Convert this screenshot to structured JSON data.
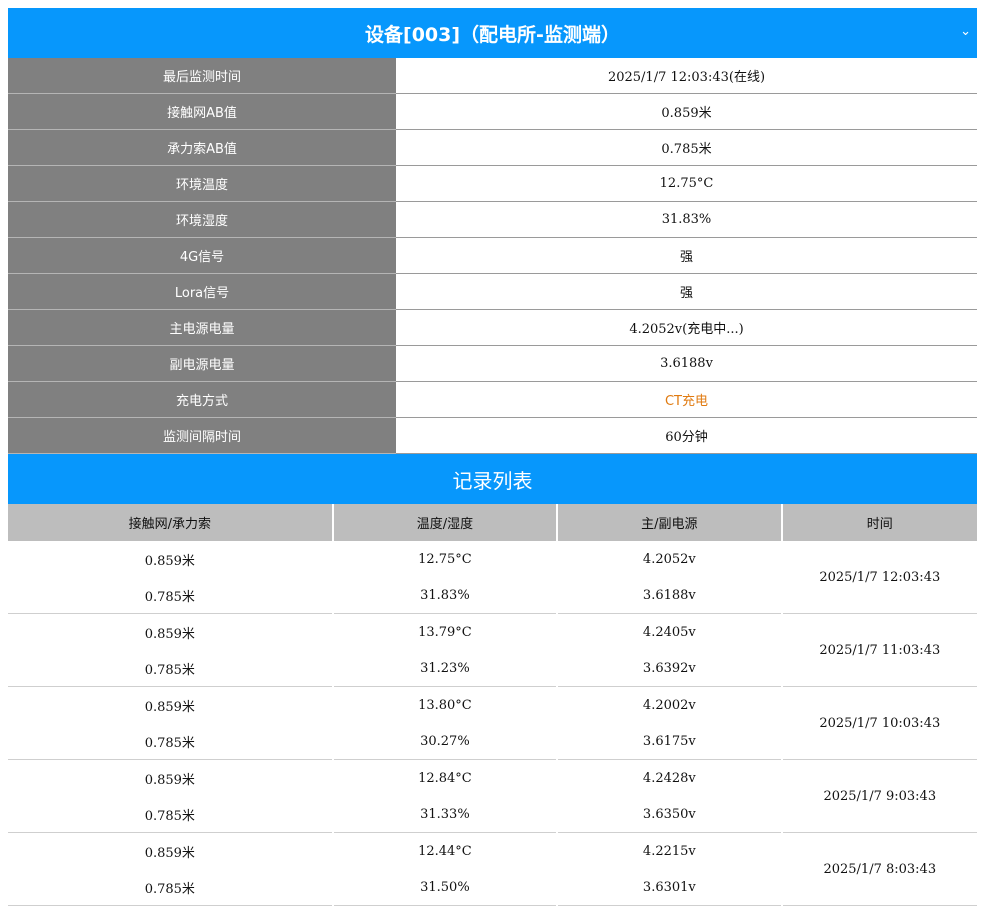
{
  "header": {
    "title": "设备[003]（配电所-监测端）",
    "collapse_icon": "chevron-down-icon"
  },
  "info": [
    {
      "label": "最后监测时间",
      "value": "2025/1/7 12:03:43(在线)"
    },
    {
      "label": "接触网AB值",
      "value": "0.859米"
    },
    {
      "label": "承力索AB值",
      "value": "0.785米"
    },
    {
      "label": "环境温度",
      "value": "12.75°C"
    },
    {
      "label": "环境湿度",
      "value": "31.83%"
    },
    {
      "label": "4G信号",
      "value": "强"
    },
    {
      "label": "Lora信号",
      "value": "强"
    },
    {
      "label": "主电源电量",
      "value": "4.2052v(充电中...)"
    },
    {
      "label": "副电源电量",
      "value": "3.6188v"
    },
    {
      "label": "充电方式",
      "value": "CT充电"
    },
    {
      "label": "监测间隔时间",
      "value": "60分钟"
    }
  ],
  "colors": {
    "accent": "#0797fc",
    "label_bg": "#808080",
    "highlight": "#e07a10"
  },
  "records": {
    "title": "记录列表",
    "columns": [
      "接触网/承力索",
      "温度/湿度",
      "主/副电源",
      "时间"
    ],
    "rows": [
      {
        "net": "0.859米",
        "cable": "0.785米",
        "temp": "12.75°C",
        "humidity": "31.83%",
        "main": "4.2052v",
        "sub": "3.6188v",
        "time": "2025/1/7 12:03:43"
      },
      {
        "net": "0.859米",
        "cable": "0.785米",
        "temp": "13.79°C",
        "humidity": "31.23%",
        "main": "4.2405v",
        "sub": "3.6392v",
        "time": "2025/1/7 11:03:43"
      },
      {
        "net": "0.859米",
        "cable": "0.785米",
        "temp": "13.80°C",
        "humidity": "30.27%",
        "main": "4.2002v",
        "sub": "3.6175v",
        "time": "2025/1/7 10:03:43"
      },
      {
        "net": "0.859米",
        "cable": "0.785米",
        "temp": "12.84°C",
        "humidity": "31.33%",
        "main": "4.2428v",
        "sub": "3.6350v",
        "time": "2025/1/7 9:03:43"
      },
      {
        "net": "0.859米",
        "cable": "0.785米",
        "temp": "12.44°C",
        "humidity": "31.50%",
        "main": "4.2215v",
        "sub": "3.6301v",
        "time": "2025/1/7 8:03:43"
      }
    ]
  }
}
